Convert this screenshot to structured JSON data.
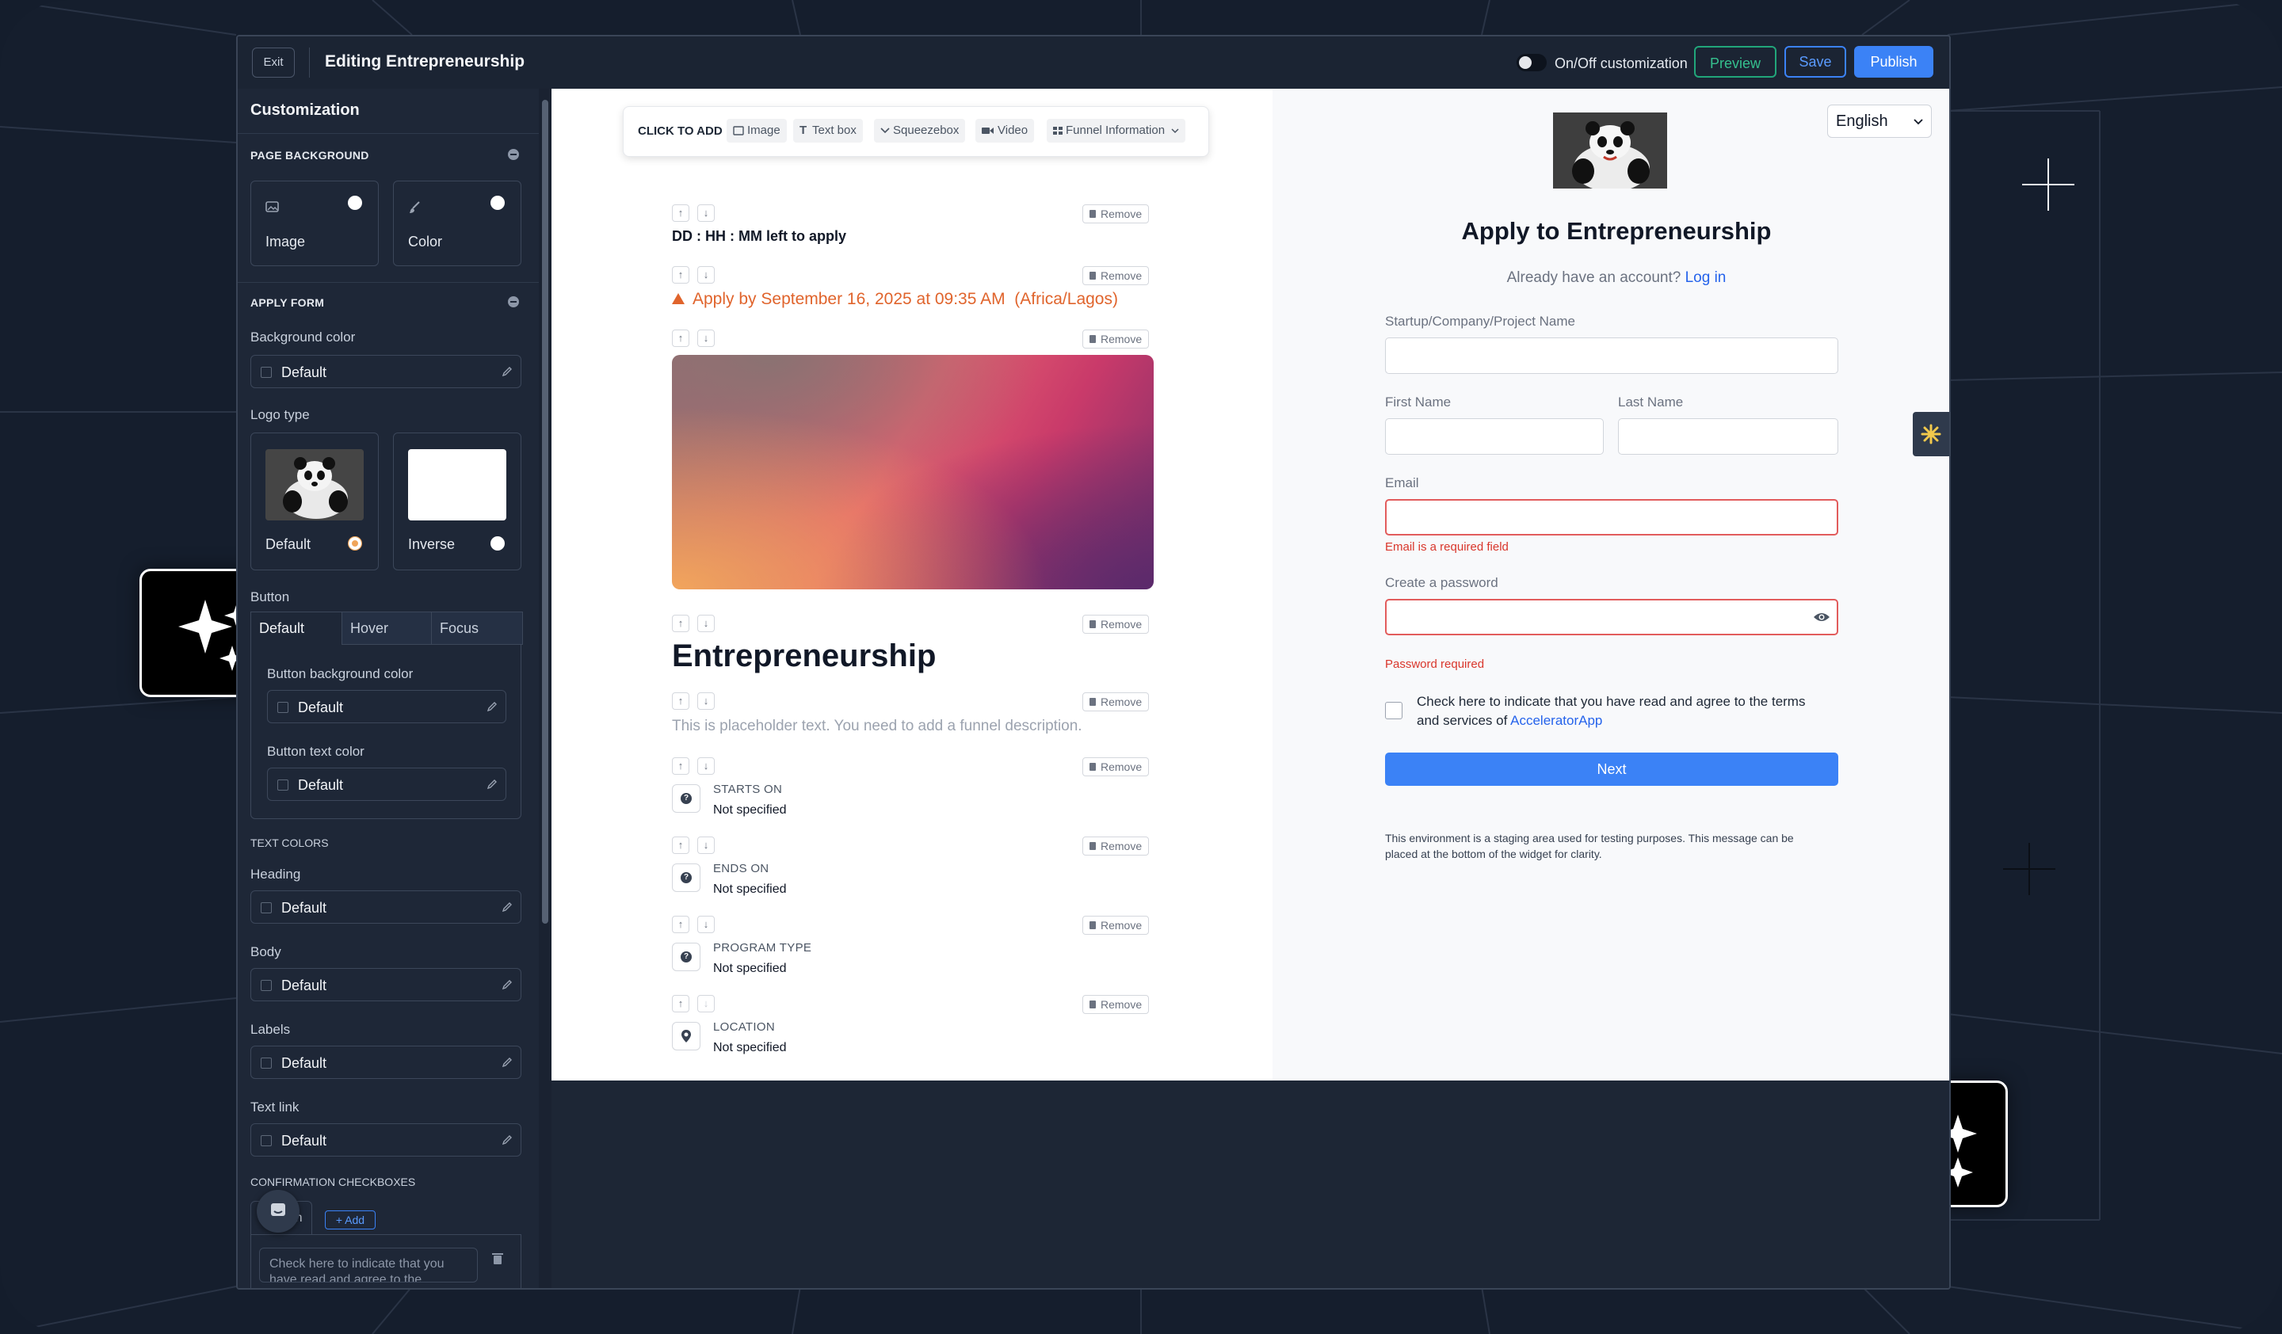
{
  "topbar": {
    "exit_label": "Exit",
    "title": "Editing Entrepreneurship",
    "toggle_label": "On/Off customization",
    "preview_label": "Preview",
    "save_label": "Save",
    "publish_label": "Publish"
  },
  "sidebar": {
    "title": "Customization",
    "page_background": {
      "heading": "PAGE BACKGROUND",
      "options": [
        {
          "label": "Image",
          "icon": "image-icon",
          "selected": false
        },
        {
          "label": "Color",
          "icon": "brush-icon",
          "selected": false
        }
      ]
    },
    "apply_form": {
      "heading": "APPLY FORM",
      "background_color_label": "Background color",
      "background_color_value": "Default",
      "logo_type_label": "Logo type",
      "logo_options": [
        {
          "label": "Default",
          "selected": true
        },
        {
          "label": "Inverse",
          "selected": false
        }
      ],
      "button_label": "Button",
      "button_tabs": [
        "Default",
        "Hover",
        "Focus"
      ],
      "button_bg_label": "Button background color",
      "button_bg_value": "Default",
      "button_text_label": "Button text color",
      "button_text_value": "Default"
    },
    "text_colors": {
      "heading": "TEXT COLORS",
      "items": [
        {
          "label": "Heading",
          "value": "Default"
        },
        {
          "label": "Body",
          "value": "Default"
        },
        {
          "label": "Labels",
          "value": "Default"
        },
        {
          "label": "Text link",
          "value": "Default"
        }
      ]
    },
    "confirmation": {
      "heading": "CONFIRMATION CHECKBOXES",
      "tab_label": "English",
      "add_label": "+ Add",
      "checkbox_text": "Check here to indicate that you have read and agree to the"
    }
  },
  "editor": {
    "click_to_add": "CLICK TO ADD",
    "add_chips": [
      "Image",
      "Text box",
      "Squeezebox",
      "Video",
      "Funnel Information"
    ],
    "remove_label": "Remove",
    "deadline_text": "DD : HH : MM left to apply",
    "apply_by_text": "Apply by September 16, 2025 at 09:35 AM  (Africa/Lagos)",
    "program_title": "Entrepreneurship",
    "description_placeholder": "This is placeholder text. You need to add a funnel description.",
    "info_items": [
      {
        "heading": "STARTS ON",
        "value": "Not specified"
      },
      {
        "heading": "ENDS ON",
        "value": "Not specified"
      },
      {
        "heading": "PROGRAM TYPE",
        "value": "Not specified"
      },
      {
        "heading": "LOCATION",
        "value": "Not specified"
      }
    ]
  },
  "preview": {
    "language": "English",
    "title": "Apply to Entrepreneurship",
    "account_prompt": "Already have an account?",
    "login_link": "Log in",
    "startup_label": "Startup/Company/Project Name",
    "first_name_label": "First Name",
    "last_name_label": "Last Name",
    "email_label": "Email",
    "email_error": "Email is a required field",
    "password_label": "Create a password",
    "password_error": "Password required",
    "terms_text": "Check here to indicate that you have read and agree to the terms",
    "terms_text_2": "and services of",
    "terms_link": "AcceleratorApp",
    "next_label": "Next",
    "footer_text_1": "This environment is a staging area used for testing purposes. This message can be",
    "footer_text_2": "placed at the bottom of the widget for clarity."
  },
  "colors": {
    "accent": "#3b82f6",
    "preview_green": "#21a67a",
    "error": "#d9362b",
    "warning": "#e0642c"
  }
}
